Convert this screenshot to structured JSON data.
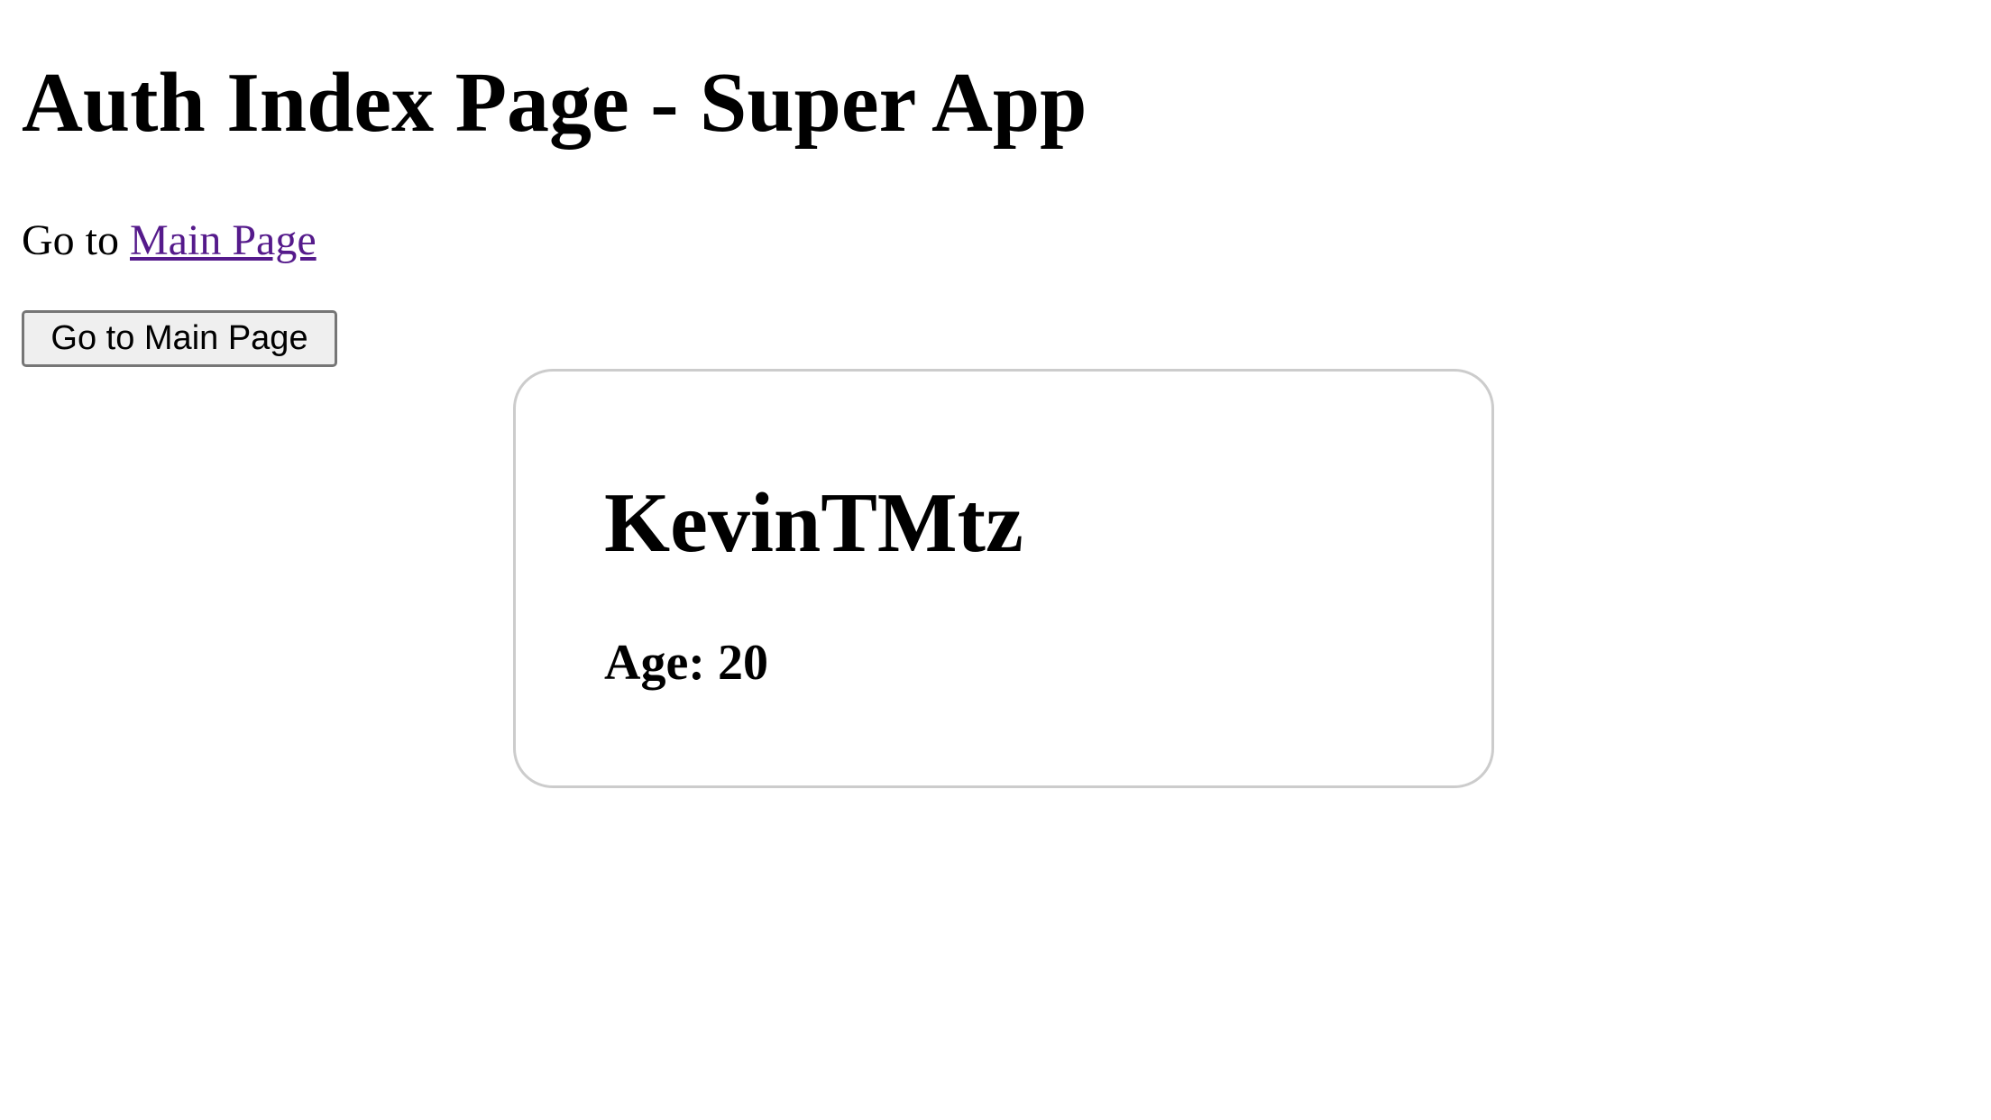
{
  "page": {
    "title": "Auth Index Page - Super App"
  },
  "navigation": {
    "goto_prefix": "Go to",
    "main_link_label": "Main Page",
    "main_button_label": "Go to Main Page"
  },
  "profile": {
    "name": "KevinTMtz",
    "age_text": "Age: 20"
  },
  "colors": {
    "link": "#551a8b",
    "card_border": "#cccccc",
    "button_background": "#efefef",
    "button_border": "#767676"
  }
}
